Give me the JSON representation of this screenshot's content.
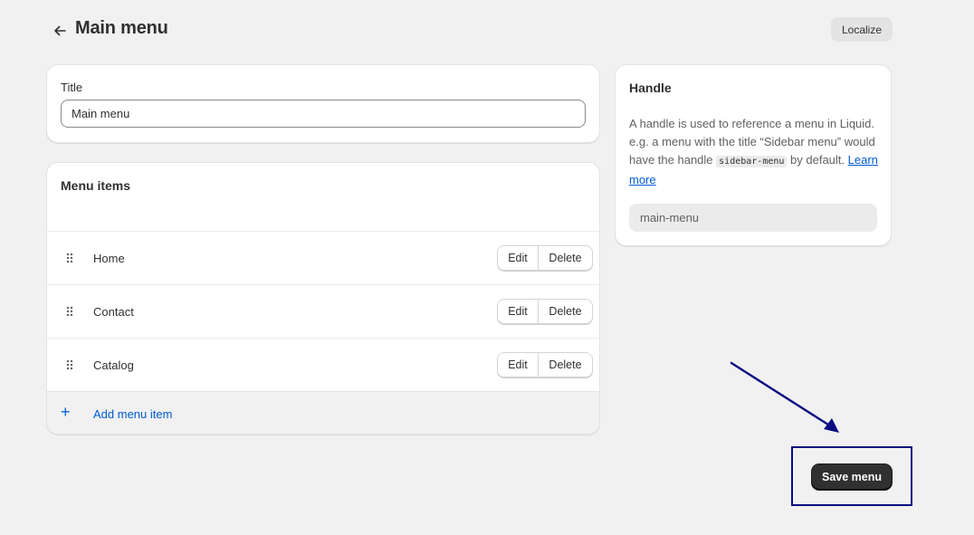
{
  "header": {
    "title": "Main menu",
    "localize_label": "Localize"
  },
  "title_card": {
    "label": "Title",
    "value": "Main menu"
  },
  "menu_card": {
    "title": "Menu items",
    "items": [
      {
        "label": "Home",
        "edit_label": "Edit",
        "delete_label": "Delete"
      },
      {
        "label": "Contact",
        "edit_label": "Edit",
        "delete_label": "Delete"
      },
      {
        "label": "Catalog",
        "edit_label": "Edit",
        "delete_label": "Delete"
      }
    ],
    "add_label": "Add menu item"
  },
  "handle_card": {
    "title": "Handle",
    "desc_part1": "A handle is used to reference a menu in Liquid. e.g. a menu with the title “Sidebar menu” would have the handle",
    "code": "sidebar-menu",
    "desc_part2": "by default.",
    "learn_more": "Learn more",
    "handle_value": "main-menu"
  },
  "footer": {
    "save_label": "Save menu"
  },
  "colors": {
    "accent": "#005bd3",
    "primary_button": "#303030",
    "annotation": "#0a0a82",
    "background": "#f1f1f1"
  },
  "icons": {
    "back": "arrow-left-icon",
    "drag": "drag-handle-icon",
    "add": "plus-icon"
  }
}
